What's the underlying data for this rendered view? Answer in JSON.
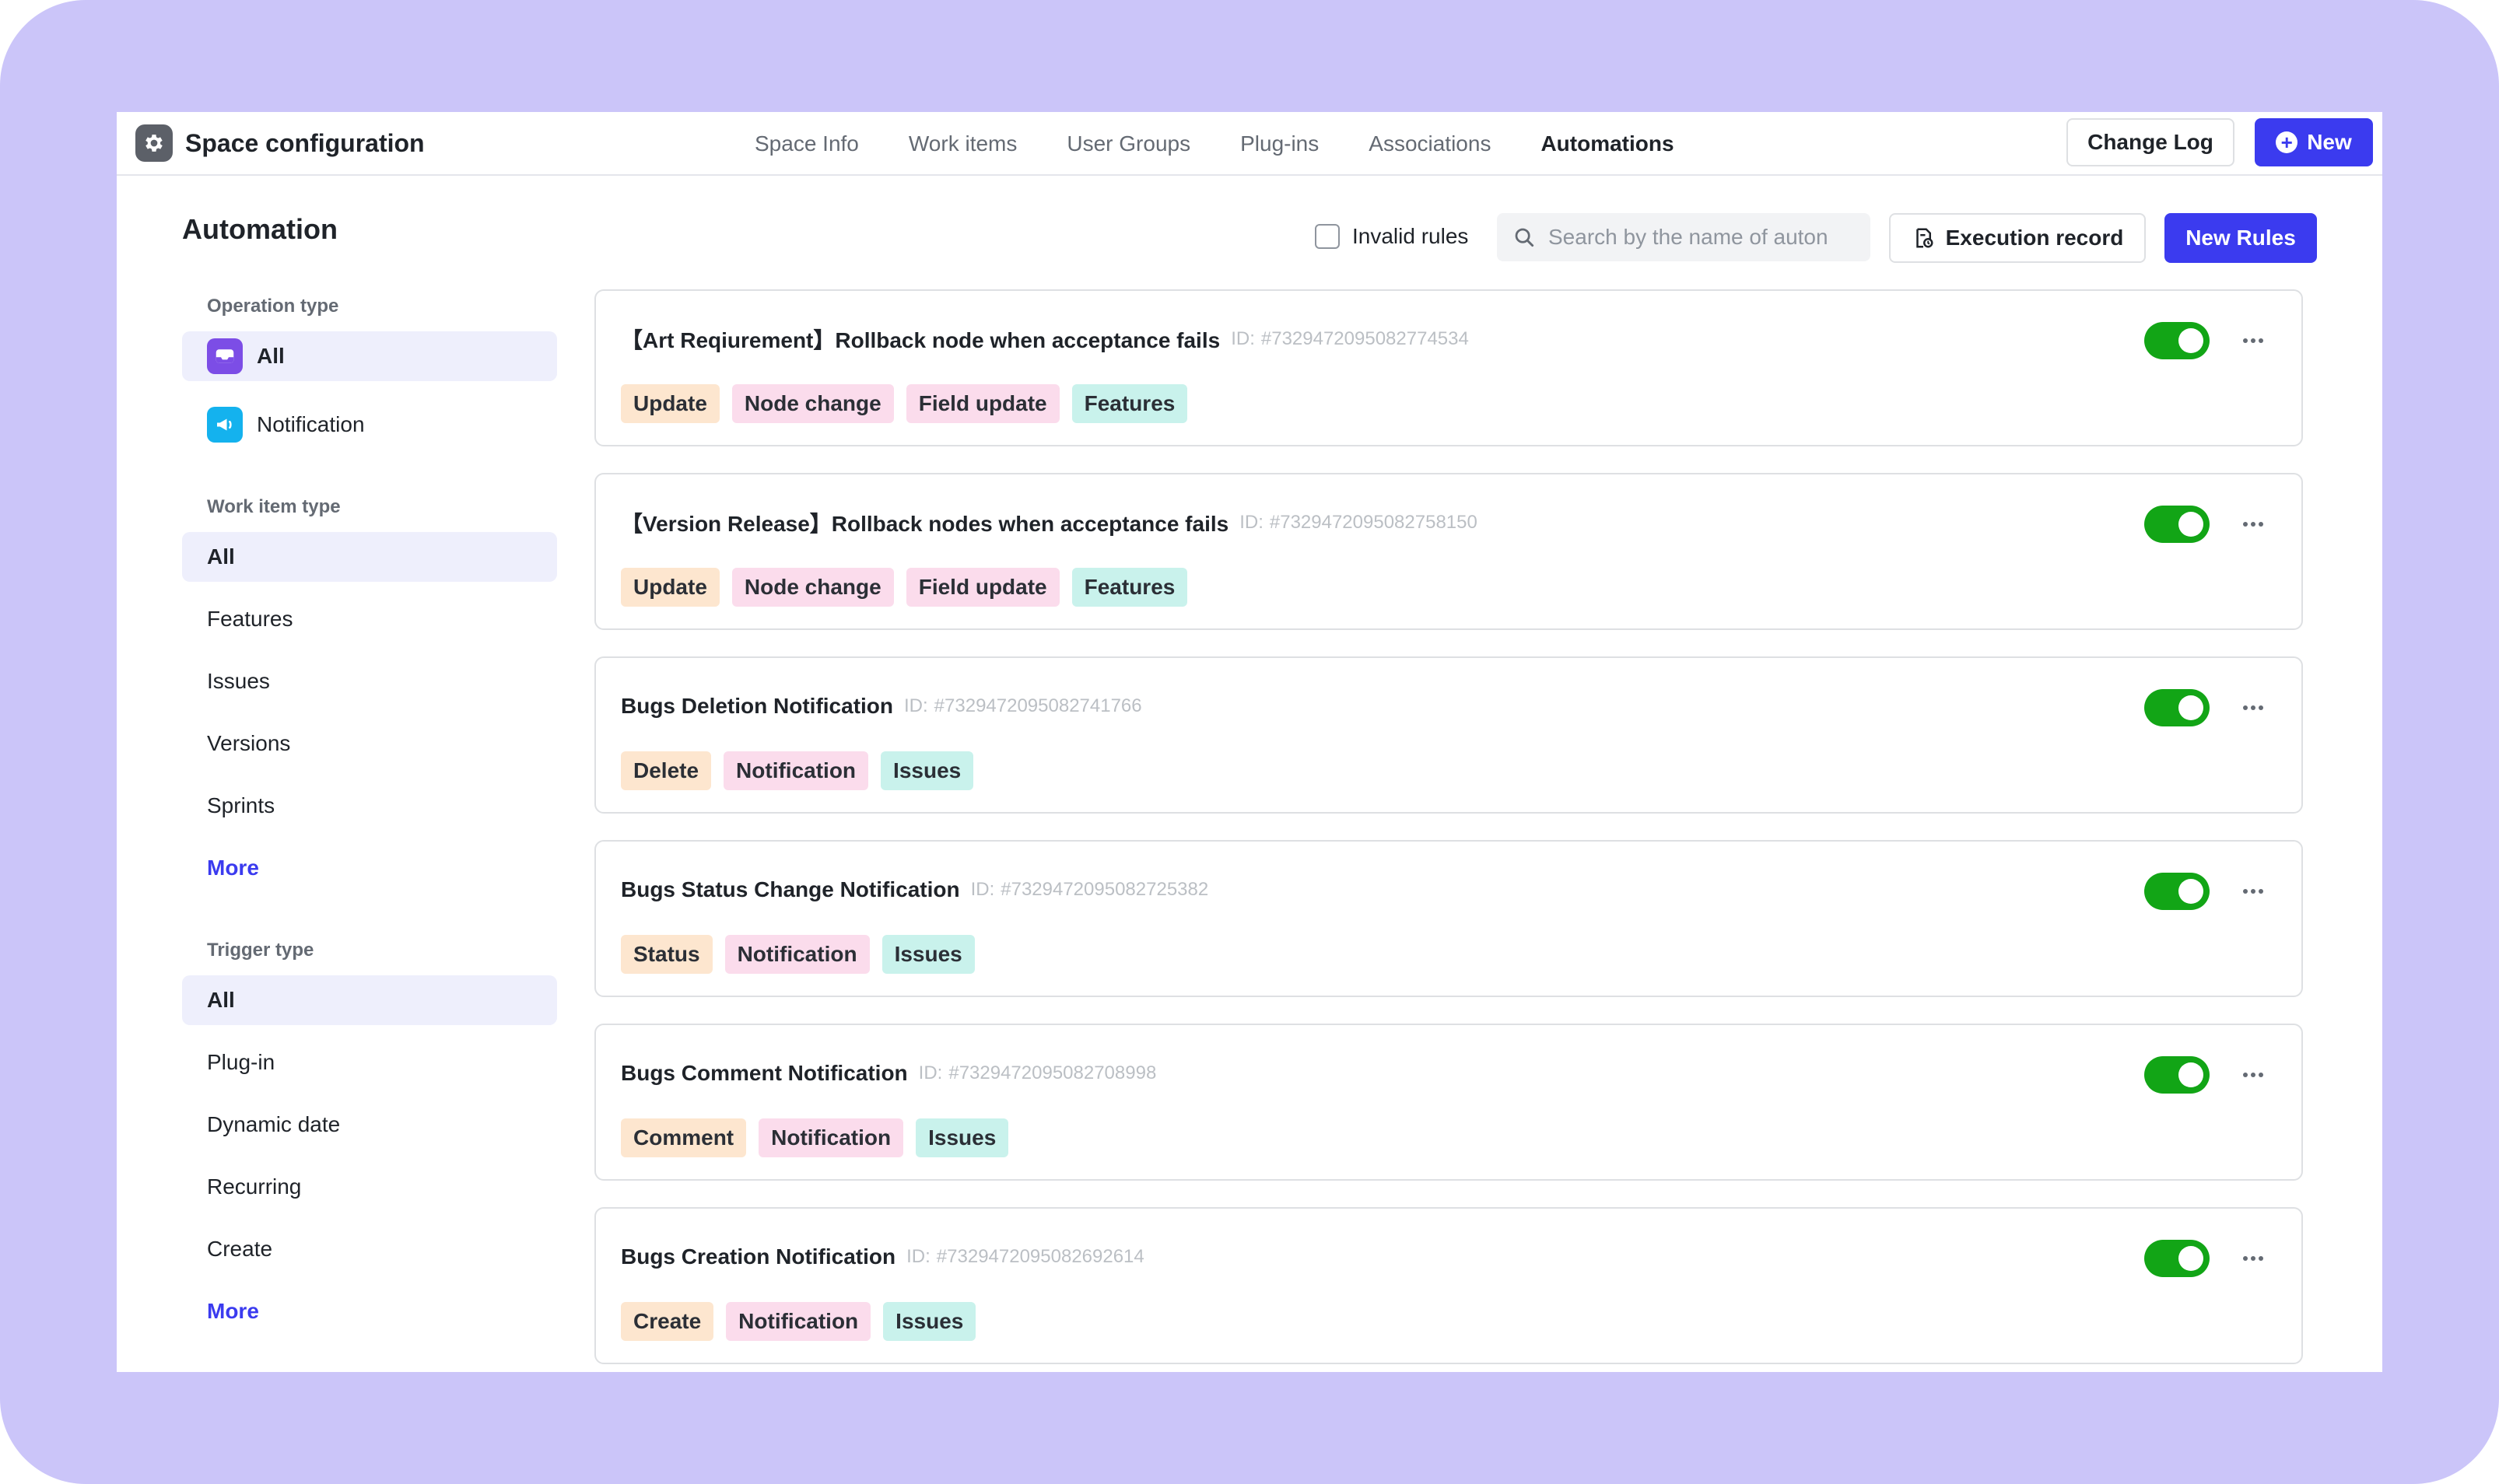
{
  "header": {
    "title": "Space configuration",
    "tabs": [
      {
        "label": "Space Info",
        "active": false
      },
      {
        "label": "Work items",
        "active": false
      },
      {
        "label": "User Groups",
        "active": false
      },
      {
        "label": "Plug-ins",
        "active": false
      },
      {
        "label": "Associations",
        "active": false
      },
      {
        "label": "Automations",
        "active": true
      }
    ],
    "change_log_label": "Change Log",
    "new_label": "New"
  },
  "page": {
    "title": "Automation"
  },
  "toolbar": {
    "invalid_rules_label": "Invalid rules",
    "invalid_rules_checked": false,
    "search_placeholder": "Search by the name of auton",
    "execution_record_label": "Execution record",
    "new_rules_label": "New Rules"
  },
  "sidebar": {
    "operation_type": {
      "title": "Operation type",
      "items": [
        {
          "label": "All",
          "icon": "inbox-icon",
          "active": true
        },
        {
          "label": "Notification",
          "icon": "megaphone-icon",
          "active": false
        }
      ]
    },
    "work_item_type": {
      "title": "Work item type",
      "items": [
        {
          "label": "All",
          "active": true
        },
        {
          "label": "Features",
          "active": false
        },
        {
          "label": "Issues",
          "active": false
        },
        {
          "label": "Versions",
          "active": false
        },
        {
          "label": "Sprints",
          "active": false
        }
      ],
      "more_label": "More"
    },
    "trigger_type": {
      "title": "Trigger type",
      "items": [
        {
          "label": "All",
          "active": true
        },
        {
          "label": "Plug-in",
          "active": false
        },
        {
          "label": "Dynamic date",
          "active": false
        },
        {
          "label": "Recurring",
          "active": false
        },
        {
          "label": "Create",
          "active": false
        }
      ],
      "more_label": "More"
    }
  },
  "colors": {
    "accent": "#3b3bef",
    "toggle_on": "#12a516",
    "tag_orange": "#fde6cf",
    "tag_pink": "#fbdcec",
    "tag_teal": "#c9f2ec"
  },
  "rules": [
    {
      "name": "【Art Reqiurement】Rollback node when acceptance fails",
      "id_label": "ID:",
      "id": "#7329472095082774534",
      "enabled": true,
      "tags": [
        {
          "label": "Update",
          "color": "orange"
        },
        {
          "label": "Node change",
          "color": "pink"
        },
        {
          "label": "Field update",
          "color": "pink"
        },
        {
          "label": "Features",
          "color": "teal"
        }
      ]
    },
    {
      "name": "【Version Release】Rollback nodes when acceptance fails",
      "id_label": "ID:",
      "id": "#7329472095082758150",
      "enabled": true,
      "tags": [
        {
          "label": "Update",
          "color": "orange"
        },
        {
          "label": "Node change",
          "color": "pink"
        },
        {
          "label": "Field update",
          "color": "pink"
        },
        {
          "label": "Features",
          "color": "teal"
        }
      ]
    },
    {
      "name": "Bugs Deletion Notification",
      "id_label": "ID:",
      "id": "#7329472095082741766",
      "enabled": true,
      "tags": [
        {
          "label": "Delete",
          "color": "orange"
        },
        {
          "label": "Notification",
          "color": "pink"
        },
        {
          "label": "Issues",
          "color": "teal"
        }
      ]
    },
    {
      "name": "Bugs Status Change Notification",
      "id_label": "ID:",
      "id": "#7329472095082725382",
      "enabled": true,
      "tags": [
        {
          "label": "Status",
          "color": "orange"
        },
        {
          "label": "Notification",
          "color": "pink"
        },
        {
          "label": "Issues",
          "color": "teal"
        }
      ]
    },
    {
      "name": "Bugs Comment Notification",
      "id_label": "ID:",
      "id": "#7329472095082708998",
      "enabled": true,
      "tags": [
        {
          "label": "Comment",
          "color": "orange"
        },
        {
          "label": "Notification",
          "color": "pink"
        },
        {
          "label": "Issues",
          "color": "teal"
        }
      ]
    },
    {
      "name": "Bugs Creation Notification",
      "id_label": "ID:",
      "id": "#7329472095082692614",
      "enabled": true,
      "tags": [
        {
          "label": "Create",
          "color": "orange"
        },
        {
          "label": "Notification",
          "color": "pink"
        },
        {
          "label": "Issues",
          "color": "teal"
        }
      ]
    }
  ]
}
